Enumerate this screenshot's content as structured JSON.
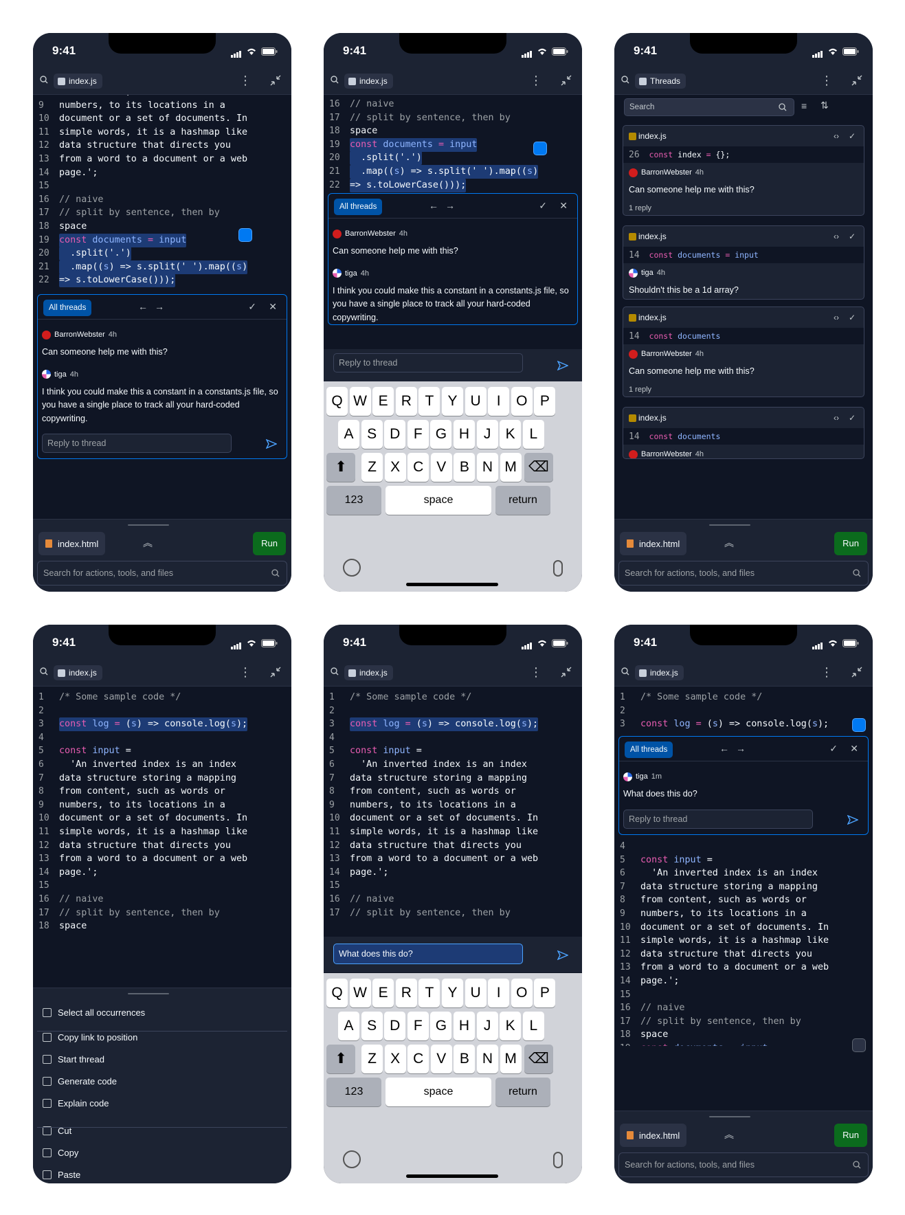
{
  "status": {
    "time": "9:41"
  },
  "tabs": {
    "file": "index.js",
    "threads": "Threads",
    "html_file": "index.html"
  },
  "actions": {
    "run": "Run",
    "search_placeholder": "Search for actions, tools, and files"
  },
  "thread": {
    "all_threads": "All threads",
    "reply_placeholder": "Reply to thread",
    "comments": [
      {
        "author": "BarronWebster",
        "ago": "4h",
        "text": "Can someone help me with this?"
      },
      {
        "author": "tiga",
        "ago": "4h",
        "text": "I think you could make this a constant in a constants.js file, so you have a single place to track all your hard-coded copywriting."
      }
    ],
    "new_comment": {
      "author": "tiga",
      "ago": "1m",
      "text": "What does this do?"
    },
    "draft": "What does this do?"
  },
  "code_lines": [
    {
      "n": "1",
      "t": "/* Some sample code */"
    },
    {
      "n": "2",
      "t": ""
    },
    {
      "n": "3",
      "t": "const log = (s) => console.log(s);"
    },
    {
      "n": "4",
      "t": ""
    },
    {
      "n": "5",
      "t": "const input ="
    },
    {
      "n": "6",
      "t": "  'An inverted index is an index"
    },
    {
      "n": "7",
      "t": "data structure storing a mapping"
    },
    {
      "n": "8",
      "t": "from content, such as words or"
    },
    {
      "n": "9",
      "t": "numbers, to its locations in a"
    },
    {
      "n": "10",
      "t": "document or a set of documents. In"
    },
    {
      "n": "11",
      "t": "simple words, it is a hashmap like"
    },
    {
      "n": "12",
      "t": "data structure that directs you"
    },
    {
      "n": "13",
      "t": "from a word to a document or a web"
    },
    {
      "n": "14",
      "t": "page.';"
    },
    {
      "n": "15",
      "t": ""
    },
    {
      "n": "16",
      "t": "// naive"
    },
    {
      "n": "17",
      "t": "// split by sentence, then by"
    },
    {
      "n": "18",
      "t": "space"
    },
    {
      "n": "19",
      "t": "const documents = input"
    },
    {
      "n": "20",
      "t": "  .split('.')"
    },
    {
      "n": "21",
      "t": "  .map((s) => s.split(' ').map((s)"
    },
    {
      "n": "22",
      "t": "=> s.toLowerCase()));"
    }
  ],
  "threads_panel": {
    "search_placeholder": "Search",
    "cards": [
      {
        "file": "index.js",
        "line": "26",
        "code": "const index = {};",
        "author": "BarronWebster",
        "ago": "4h",
        "text": "Can someone help me with this?",
        "replies": "1 reply"
      },
      {
        "file": "index.js",
        "line": "14",
        "code": "const documents = input",
        "author": "tiga",
        "ago": "4h",
        "text": "Shouldn't this be a 1d array?",
        "replies": ""
      },
      {
        "file": "index.js",
        "line": "14",
        "code": "const documents",
        "author": "BarronWebster",
        "ago": "4h",
        "text": "Can someone help me with this?",
        "replies": "1 reply"
      },
      {
        "file": "index.js",
        "line": "14",
        "code": "const documents",
        "author": "BarronWebster",
        "ago": "4h",
        "text": "",
        "replies": ""
      }
    ]
  },
  "context_menu": {
    "items": [
      "Select all occurrences",
      "Copy link to position",
      "Start thread",
      "Generate code",
      "Explain code",
      "Cut",
      "Copy",
      "Paste"
    ],
    "icons": [
      "select-icon",
      "link-icon",
      "thread-icon",
      "code-icon",
      "book-icon",
      "scissors-icon",
      "copy-icon",
      "clipboard-icon"
    ]
  },
  "keyboard": {
    "row1": [
      "Q",
      "W",
      "E",
      "R",
      "T",
      "Y",
      "U",
      "I",
      "O",
      "P"
    ],
    "row2": [
      "A",
      "S",
      "D",
      "F",
      "G",
      "H",
      "J",
      "K",
      "L"
    ],
    "row3": [
      "Z",
      "X",
      "C",
      "V",
      "B",
      "N",
      "M"
    ],
    "numbers": "123",
    "space": "space",
    "return": "return"
  },
  "colors": {
    "accent": "#0079f2",
    "run": "#0b6b1d",
    "bg": "#0f1524",
    "surface": "#1c2333"
  }
}
